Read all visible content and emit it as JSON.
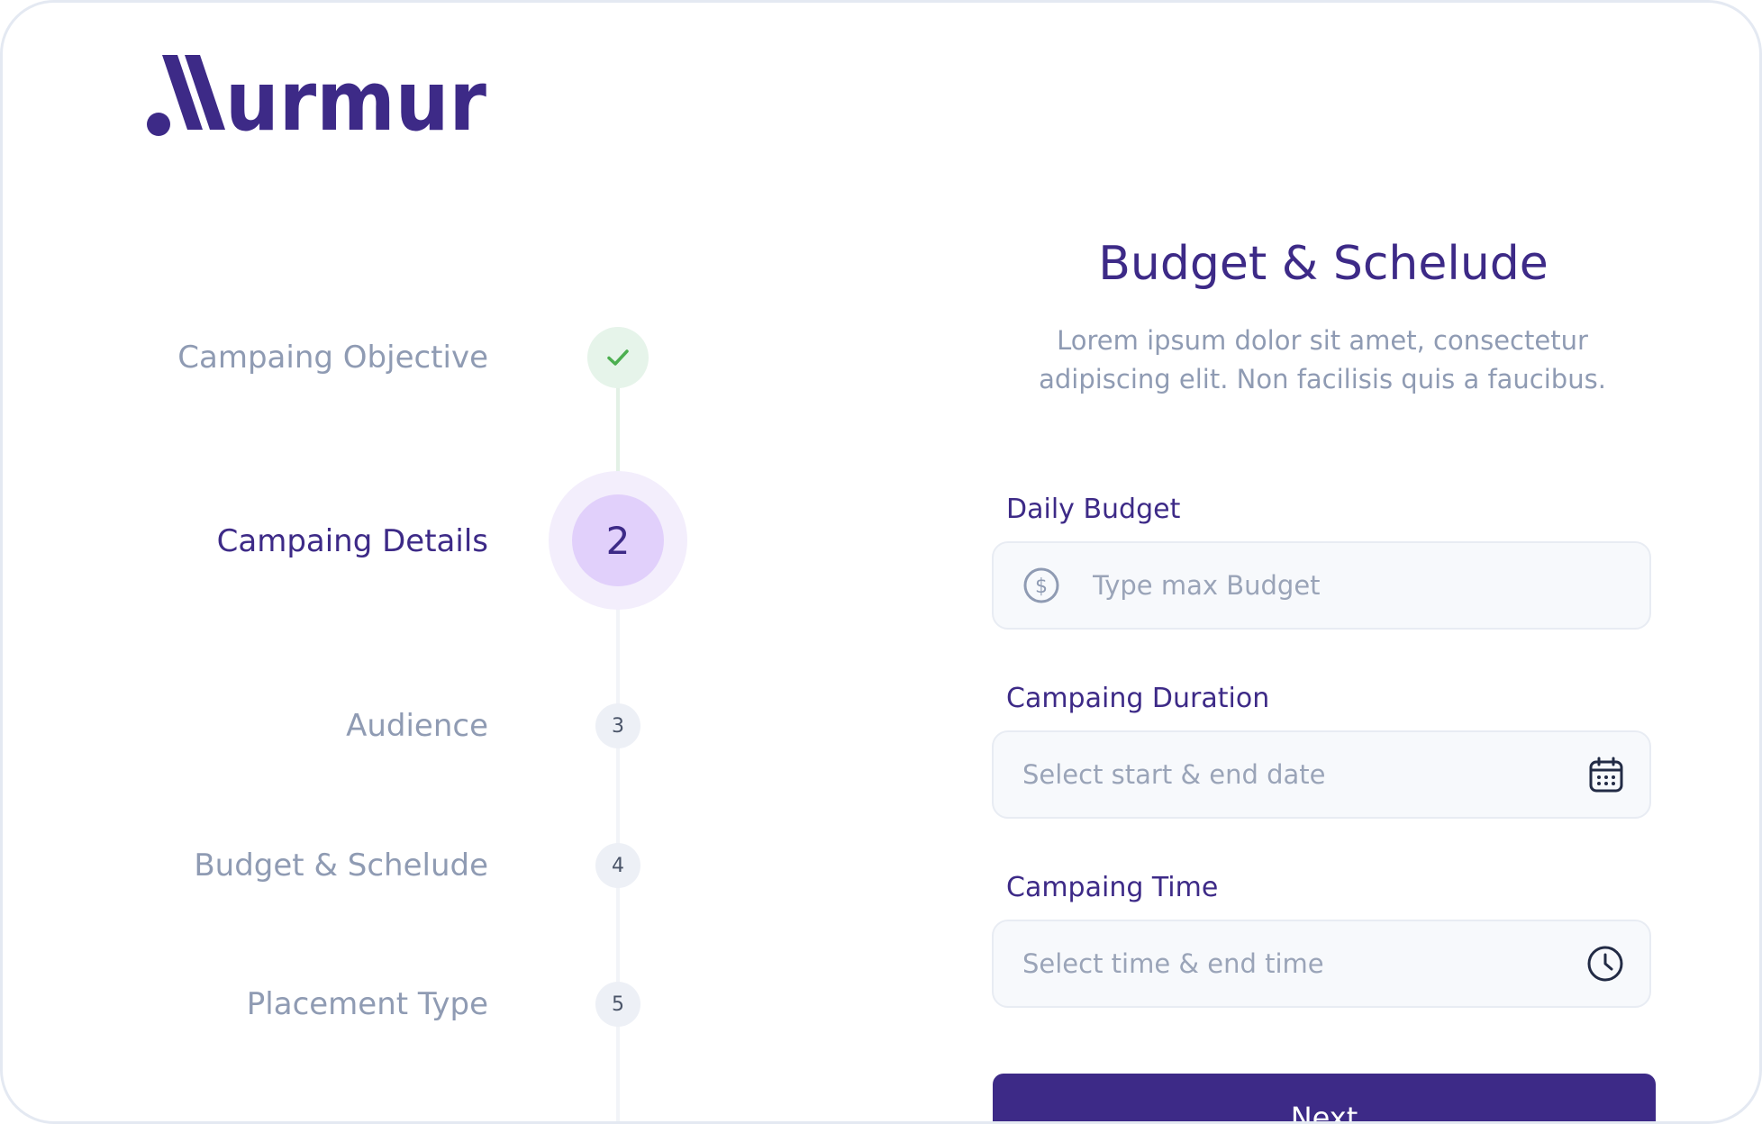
{
  "brand": {
    "name": "Murmur",
    "color": "#3d2a87"
  },
  "steps": [
    {
      "label": "Campaing Objective",
      "status": "completed"
    },
    {
      "label": "Campaing Details",
      "number": "2",
      "status": "current"
    },
    {
      "label": "Audience",
      "number": "3",
      "status": "pending"
    },
    {
      "label": "Budget & Schelude",
      "number": "4",
      "status": "pending"
    },
    {
      "label": "Placement Type",
      "number": "5",
      "status": "pending"
    }
  ],
  "form": {
    "title": "Budget & Schelude",
    "description": "Lorem ipsum dolor sit amet, consectetur adipiscing elit. Non facilisis quis a faucibus.",
    "fields": [
      {
        "label": "Daily Budget",
        "placeholder": "Type max Budget",
        "icon": "dollar-circle-icon"
      },
      {
        "label": "Campaing Duration",
        "placeholder": "Select start & end date",
        "icon": "calendar-icon"
      },
      {
        "label": "Campaing Time",
        "placeholder": "Select time & end time",
        "icon": "clock-icon"
      }
    ],
    "next_label": "Next"
  },
  "colors": {
    "primary": "#3d2a87",
    "success": "#4caf50",
    "current_step": "#e1d0fb",
    "muted": "#8f9bb3"
  }
}
